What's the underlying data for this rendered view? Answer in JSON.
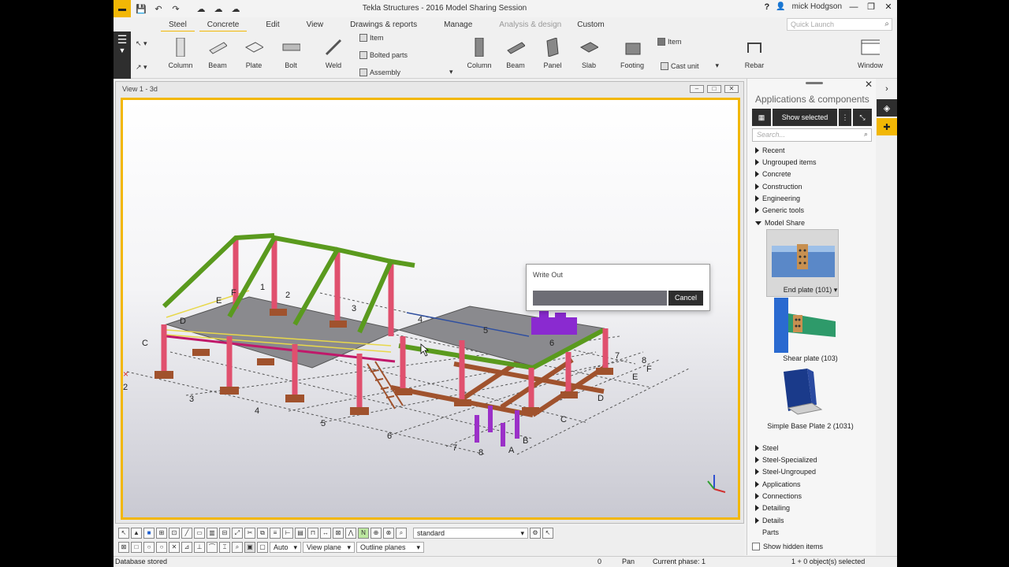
{
  "titlebar": {
    "app_title": "Tekla Structures - 2016 Model Sharing Session",
    "help": "?",
    "user": "mick Hodgson"
  },
  "ribbon_tabs": [
    "Steel",
    "Concrete",
    "Edit",
    "View",
    "Drawings & reports",
    "Manage",
    "Analysis & design",
    "Custom"
  ],
  "quick_launch": {
    "placeholder": "Quick Launch"
  },
  "steel_tools": {
    "column": "Column",
    "beam": "Beam",
    "plate": "Plate",
    "bolt": "Bolt",
    "weld": "Weld",
    "item": "Item",
    "bolted_parts": "Bolted parts",
    "assembly": "Assembly"
  },
  "concrete_tools": {
    "column": "Column",
    "beam": "Beam",
    "panel": "Panel",
    "slab": "Slab",
    "footing": "Footing",
    "item": "Item",
    "cast_unit": "Cast unit",
    "rebar": "Rebar",
    "window": "Window"
  },
  "view": {
    "title": "View 1 - 3d",
    "grid_labels": {
      "letters_left": [
        "C",
        "D",
        "E",
        "F"
      ],
      "letters_right": [
        "A",
        "B",
        "C",
        "D",
        "E",
        "F"
      ],
      "numbers_front": [
        "2",
        "3",
        "4",
        "5",
        "6",
        "7",
        "8"
      ],
      "numbers_back": [
        "1",
        "2",
        "3",
        "4",
        "5",
        "6",
        "7",
        "8"
      ]
    }
  },
  "dialog": {
    "title": "Write Out",
    "cancel": "Cancel"
  },
  "panel": {
    "title": "Applications & components",
    "show_selected": "Show selected",
    "search_placeholder": "Search...",
    "tree_top": [
      "Recent",
      "Ungrouped items",
      "Concrete",
      "Construction",
      "Engineering",
      "Generic tools",
      "Model Share"
    ],
    "components": [
      "End plate (101)",
      "Shear plate (103)",
      "Simple Base Plate 2 (1031)"
    ],
    "tree_bottom": [
      "Steel",
      "Steel-Specialized",
      "Steel-Ungrouped",
      "Applications",
      "Connections",
      "Detailing",
      "Details",
      "Parts"
    ],
    "show_hidden": "Show hidden items"
  },
  "bottom_tools": {
    "standard": "standard",
    "auto": "Auto",
    "view_plane": "View plane",
    "outline_planes": "Outline planes"
  },
  "status": {
    "message": "Database stored",
    "count": "0",
    "mode": "Pan",
    "phase": "Current phase: 1",
    "selection": "1 + 0 object(s) selected"
  },
  "colors": {
    "accent": "#f2b705",
    "column_red": "#e0506e",
    "rafter_green": "#5a9a1e",
    "foundation_brown": "#a0522d",
    "deck_gray": "#8a8a8e"
  }
}
